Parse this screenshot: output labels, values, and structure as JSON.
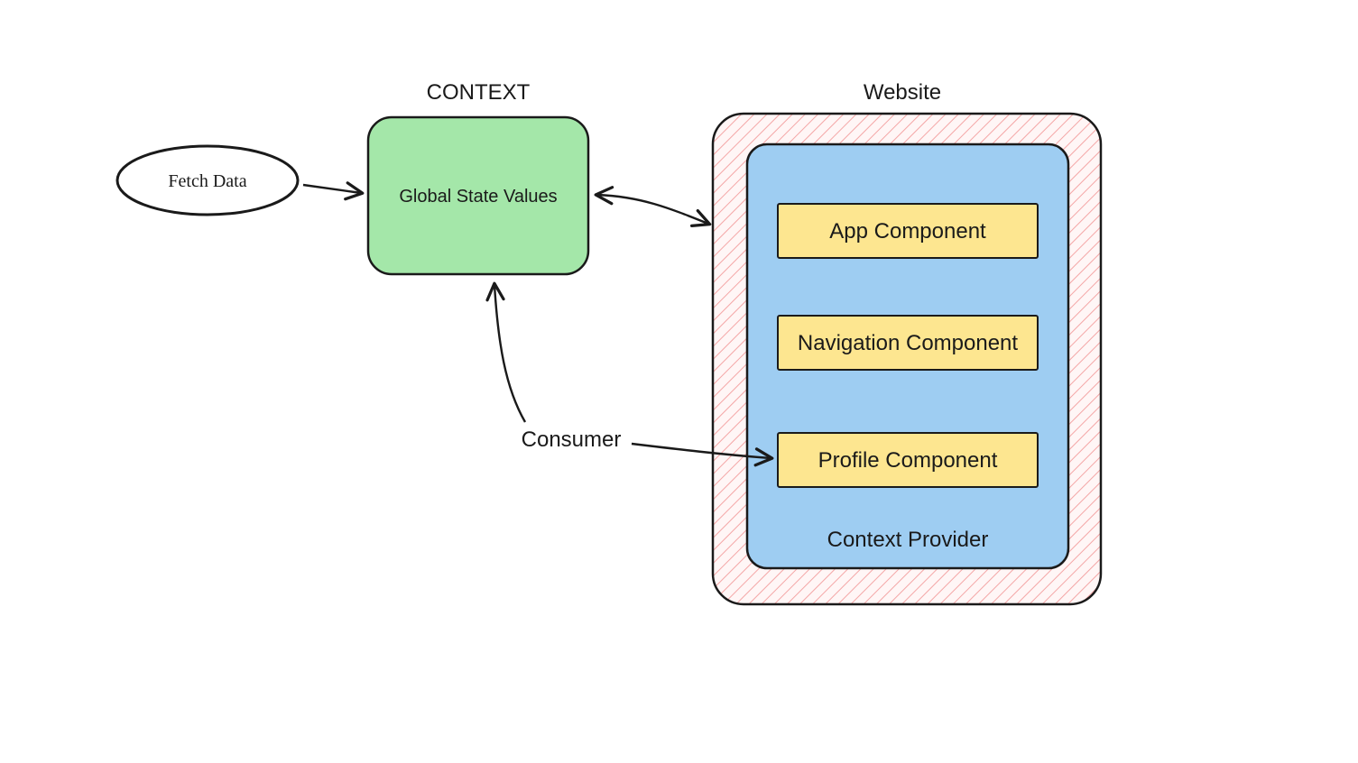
{
  "labels": {
    "context_title": "CONTEXT",
    "website_title": "Website",
    "fetch_data": "Fetch Data",
    "global_state": "Global State Values",
    "context_provider": "Context Provider",
    "consumer": "Consumer"
  },
  "components": {
    "app": "App Component",
    "navigation": "Navigation Component",
    "profile": "Profile Component"
  },
  "colors": {
    "context_box_fill": "#a4e7a9",
    "provider_fill": "#9ecdf2",
    "component_fill": "#fde690",
    "website_hatch": "#f4a6a6",
    "stroke": "#1a1a1a"
  }
}
